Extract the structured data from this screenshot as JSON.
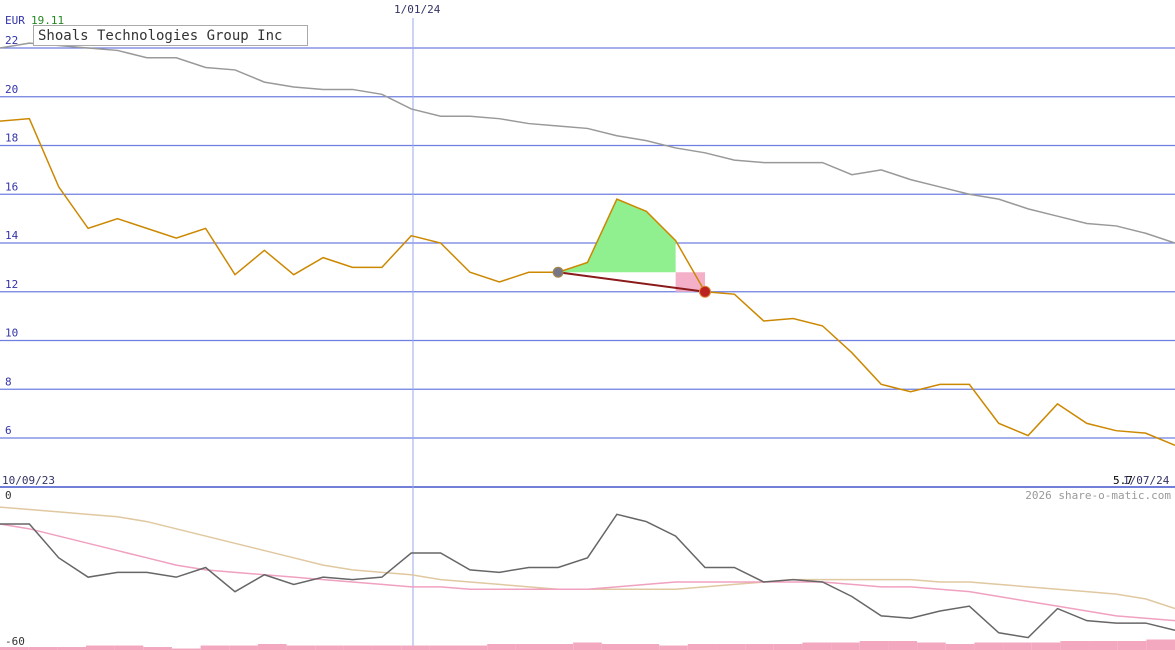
{
  "chart_data": [
    {
      "type": "line",
      "title": "Shoals Technologies Group Inc",
      "currency_label": "EUR",
      "current_value_label": "19.11",
      "last_value_label": "5.7",
      "ylim": [
        4.5,
        23
      ],
      "y_ticks": [
        6,
        8,
        10,
        12,
        14,
        16,
        18,
        20,
        22
      ],
      "x_labels": {
        "start": "10/09/23",
        "mid": "1/01/24",
        "end": "1/07/24"
      },
      "grid": true,
      "series": [
        {
          "name": "",
          "color": "#cc8800",
          "values": [
            19.0,
            19.1,
            16.3,
            14.6,
            15.0,
            14.6,
            14.2,
            14.6,
            12.7,
            13.7,
            12.7,
            13.4,
            13.0,
            13.0,
            14.3,
            14.0,
            12.8,
            12.4,
            12.8,
            12.8,
            13.2,
            15.8,
            15.3,
            14.1,
            12.0,
            11.9,
            10.8,
            10.9,
            10.6,
            9.5,
            8.2,
            7.9,
            8.2,
            8.2,
            6.6,
            6.1,
            7.4,
            6.6,
            6.3,
            6.2,
            5.7
          ]
        },
        {
          "name": "",
          "color": "#999999",
          "values": [
            22.0,
            22.2,
            22.1,
            22.0,
            21.9,
            21.6,
            21.6,
            21.2,
            21.1,
            20.6,
            20.4,
            20.3,
            20.3,
            20.1,
            19.5,
            19.2,
            19.2,
            19.1,
            18.9,
            18.8,
            18.7,
            18.4,
            18.2,
            17.9,
            17.7,
            17.4,
            17.3,
            17.3,
            17.3,
            16.8,
            17.0,
            16.6,
            16.3,
            16.0,
            15.8,
            15.4,
            15.1,
            14.8,
            14.7,
            14.4,
            14.0
          ]
        }
      ],
      "annotations": {
        "trade_start": {
          "index": 19,
          "value": 12.8
        },
        "trade_end": {
          "index": 24,
          "value": 12.0
        },
        "gain_peak": {
          "index": 21,
          "value": 15.8
        }
      }
    },
    {
      "type": "line",
      "ylim": [
        -60,
        0
      ],
      "y_ticks": [
        0,
        -60
      ],
      "series": [
        {
          "name": "",
          "color": "#666666",
          "values": [
            -12,
            -12,
            -26,
            -34,
            -32,
            -32,
            -34,
            -30,
            -40,
            -33,
            -37,
            -34,
            -35,
            -34,
            -24,
            -24,
            -31,
            -32,
            -30,
            -30,
            -26,
            -8,
            -11,
            -17,
            -30,
            -30,
            -36,
            -35,
            -36,
            -42,
            -50,
            -51,
            -48,
            -46,
            -57,
            -59,
            -47,
            -52,
            -53,
            -53,
            -56
          ]
        },
        {
          "name": "",
          "color": "#f0a0c0",
          "values": [
            -12,
            -14,
            -17,
            -20,
            -23,
            -26,
            -29,
            -31,
            -32,
            -33,
            -34,
            -35,
            -36,
            -37,
            -38,
            -38,
            -39,
            -39,
            -39,
            -39,
            -39,
            -38,
            -37,
            -36,
            -36,
            -36,
            -36,
            -36,
            -36,
            -37,
            -38,
            -38,
            -39,
            -40,
            -42,
            -44,
            -46,
            -48,
            -50,
            -51,
            -52
          ]
        },
        {
          "name": "",
          "color": "#e0c8a0",
          "values": [
            -5,
            -6,
            -7,
            -8,
            -9,
            -11,
            -14,
            -17,
            -20,
            -23,
            -26,
            -29,
            -31,
            -32,
            -33,
            -35,
            -36,
            -37,
            -38,
            -39,
            -39,
            -39,
            -39,
            -39,
            -38,
            -37,
            -36,
            -35,
            -35,
            -35,
            -35,
            -35,
            -36,
            -36,
            -37,
            -38,
            -39,
            -40,
            -41,
            -43,
            -47
          ]
        }
      ],
      "volume": [
        2,
        2,
        2,
        3,
        3,
        2,
        1,
        3,
        3,
        4,
        3,
        3,
        3,
        3,
        3,
        3,
        3,
        4,
        4,
        4,
        5,
        4,
        4,
        3,
        4,
        4,
        4,
        4,
        5,
        5,
        6,
        6,
        5,
        4,
        5,
        5,
        5,
        6,
        6,
        6,
        7
      ]
    }
  ]
}
